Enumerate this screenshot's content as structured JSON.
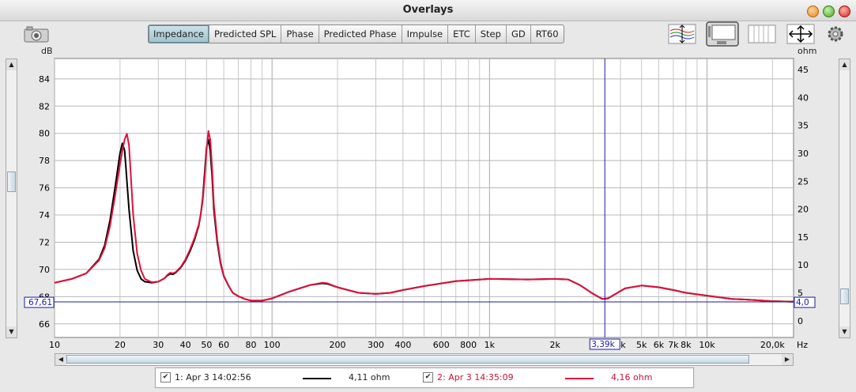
{
  "window": {
    "title": "Overlays"
  },
  "toolbar": {
    "tabs": [
      {
        "label": "Impedance",
        "active": true
      },
      {
        "label": "Predicted SPL",
        "active": false
      },
      {
        "label": "Phase",
        "active": false
      },
      {
        "label": "Predicted Phase",
        "active": false
      },
      {
        "label": "Impulse",
        "active": false
      },
      {
        "label": "ETC",
        "active": false
      },
      {
        "label": "Step",
        "active": false
      },
      {
        "label": "GD",
        "active": false
      },
      {
        "label": "RT60",
        "active": false
      }
    ],
    "icons": [
      "camera-icon",
      "graph-compress-icon",
      "control-panel-icon",
      "columns-icon",
      "move-arrows-icon",
      "gear-icon"
    ]
  },
  "axes": {
    "left_unit": "dB",
    "right_unit": "ohm",
    "x_unit": "Hz"
  },
  "cursor": {
    "y_left_readout": "67,61",
    "y_right_readout": "4,0",
    "x_readout": "3,39k"
  },
  "legend": [
    {
      "label": "1: Apr 3 14:02:56",
      "value": "4,11 ohm",
      "color": "#000000",
      "checked": true
    },
    {
      "label": "2: Apr 3 14:35:09",
      "value": "4,16 ohm",
      "color": "#e0103a",
      "checked": true
    }
  ],
  "chart_data": {
    "type": "line",
    "x_scale": "log",
    "xlim": [
      10,
      25000
    ],
    "ylim_left": [
      65,
      85.5
    ],
    "ylim_right": [
      -3,
      47
    ],
    "grid": true,
    "x_ticks": [
      {
        "v": 10,
        "label": "10"
      },
      {
        "v": 20,
        "label": "20"
      },
      {
        "v": 30,
        "label": "30"
      },
      {
        "v": 40,
        "label": "40"
      },
      {
        "v": 50,
        "label": "50"
      },
      {
        "v": 60,
        "label": "60"
      },
      {
        "v": 80,
        "label": "80"
      },
      {
        "v": 100,
        "label": "100"
      },
      {
        "v": 200,
        "label": "200"
      },
      {
        "v": 300,
        "label": "300"
      },
      {
        "v": 400,
        "label": "400"
      },
      {
        "v": 600,
        "label": "600"
      },
      {
        "v": 800,
        "label": "800"
      },
      {
        "v": 1000,
        "label": "1k"
      },
      {
        "v": 2000,
        "label": "2k"
      },
      {
        "v": 4000,
        "label": "4k"
      },
      {
        "v": 5000,
        "label": "5k"
      },
      {
        "v": 6000,
        "label": "6k"
      },
      {
        "v": 7000,
        "label": "7k"
      },
      {
        "v": 8000,
        "label": "8k"
      },
      {
        "v": 10000,
        "label": "10k"
      },
      {
        "v": 20000,
        "label": "20,0k"
      }
    ],
    "y_left_ticks": [
      66,
      68,
      70,
      72,
      74,
      76,
      78,
      80,
      82,
      84
    ],
    "y_right_ticks": [
      0,
      5,
      10,
      15,
      20,
      25,
      30,
      35,
      40,
      45
    ],
    "cursor": {
      "x": 3390,
      "y_left": 67.61
    },
    "series": [
      {
        "color": "#000000",
        "x": [
          10,
          12,
          14,
          16,
          17,
          18,
          19,
          20,
          20.5,
          21,
          22,
          23,
          24,
          25,
          26,
          28,
          30,
          32,
          33,
          34,
          35,
          36,
          38,
          40,
          42,
          44,
          46,
          47,
          48,
          49,
          50,
          51,
          52,
          53,
          54,
          56,
          58,
          60,
          63,
          66,
          70,
          75,
          80,
          90,
          100,
          120,
          150,
          170,
          180,
          200,
          250,
          300,
          350,
          400,
          500,
          700,
          1000,
          1500,
          2000,
          2300,
          2600,
          3000,
          3300,
          3500,
          3800,
          4200,
          5000,
          6000,
          7000,
          8000,
          10000,
          13000,
          15000,
          20000,
          25000
        ],
        "y": [
          6.8,
          7.5,
          8.5,
          11.0,
          13.5,
          18.0,
          24.0,
          30.0,
          31.8,
          30.5,
          20.0,
          12.5,
          9.0,
          7.5,
          7.0,
          6.8,
          7.0,
          7.6,
          8.1,
          8.4,
          8.3,
          8.6,
          9.5,
          10.8,
          12.5,
          14.5,
          17.0,
          19.0,
          22.0,
          26.5,
          31.0,
          32.5,
          30.5,
          26.0,
          20.0,
          14.0,
          10.2,
          8.0,
          6.3,
          5.0,
          4.4,
          3.9,
          3.6,
          3.6,
          4.0,
          5.2,
          6.4,
          6.7,
          6.6,
          6.0,
          5.0,
          4.8,
          5.0,
          5.5,
          6.2,
          7.1,
          7.5,
          7.4,
          7.5,
          7.4,
          6.4,
          4.8,
          3.9,
          4.0,
          4.8,
          5.8,
          6.3,
          6.0,
          5.5,
          5.0,
          4.5,
          3.9,
          3.8,
          3.5,
          3.4
        ]
      },
      {
        "color": "#e0103a",
        "x": [
          10,
          12,
          14,
          16,
          17,
          18,
          19,
          20,
          20.5,
          21,
          21.5,
          22,
          23,
          24,
          25,
          26,
          28,
          30,
          32,
          33,
          34,
          35,
          36,
          38,
          40,
          42,
          44,
          46,
          47,
          48,
          49,
          50,
          51,
          52,
          53,
          54,
          56,
          58,
          60,
          63,
          66,
          70,
          75,
          80,
          90,
          100,
          120,
          150,
          170,
          180,
          200,
          250,
          300,
          350,
          400,
          500,
          700,
          1000,
          1500,
          2000,
          2300,
          2600,
          3000,
          3300,
          3500,
          3800,
          4200,
          5000,
          6000,
          7000,
          8000,
          10000,
          13000,
          15000,
          20000,
          25000
        ],
        "y": [
          6.8,
          7.5,
          8.5,
          10.8,
          13.0,
          17.0,
          22.5,
          28.0,
          30.5,
          32.5,
          33.5,
          31.5,
          19.0,
          12.0,
          9.0,
          7.5,
          6.9,
          7.0,
          7.6,
          8.2,
          8.6,
          8.5,
          8.7,
          9.6,
          11.0,
          12.8,
          14.8,
          17.2,
          19.0,
          21.5,
          25.5,
          30.5,
          34.0,
          32.5,
          27.5,
          21.0,
          14.5,
          10.5,
          8.1,
          6.3,
          5.0,
          4.4,
          3.9,
          3.6,
          3.6,
          4.0,
          5.2,
          6.4,
          6.8,
          6.7,
          6.0,
          5.0,
          4.8,
          5.0,
          5.5,
          6.2,
          7.1,
          7.5,
          7.4,
          7.5,
          7.4,
          6.4,
          4.8,
          3.9,
          4.0,
          4.8,
          5.8,
          6.3,
          6.0,
          5.5,
          5.0,
          4.5,
          3.9,
          3.8,
          3.5,
          3.4
        ]
      }
    ]
  }
}
